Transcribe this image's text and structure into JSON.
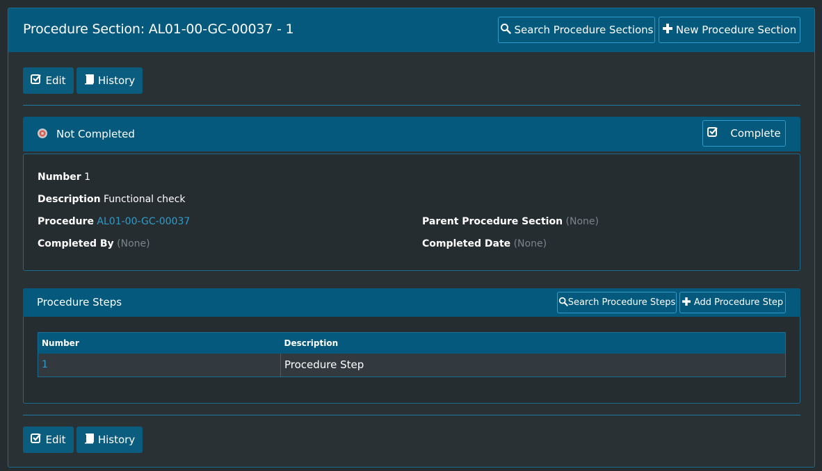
{
  "page": {
    "title": "Procedure Section: AL01-00-GC-00037 - 1",
    "search_sections_label": "Search Procedure Sections",
    "new_section_label": "New Procedure Section"
  },
  "toolbar_top": {
    "edit_label": "Edit",
    "history_label": "History"
  },
  "status": {
    "label": "Not Completed",
    "complete_label": "Complete",
    "icon_color": "#e05a4e"
  },
  "details": {
    "number_label": "Number",
    "number_value": "1",
    "description_label": "Description",
    "description_value": "Functional check",
    "procedure_label": "Procedure",
    "procedure_value": "AL01-00-GC-00037",
    "parent_label": "Parent Procedure Section",
    "parent_value": "(None)",
    "completed_by_label": "Completed By",
    "completed_by_value": "(None)",
    "completed_date_label": "Completed Date",
    "completed_date_value": "(None)"
  },
  "steps": {
    "title": "Procedure Steps",
    "search_label": "Search Procedure Steps",
    "add_label": "Add Procedure Step",
    "columns": [
      "Number",
      "Description"
    ],
    "rows": [
      {
        "number": "1",
        "description": "Procedure Step"
      }
    ]
  },
  "toolbar_bottom": {
    "edit_label": "Edit",
    "history_label": "History"
  },
  "colors": {
    "accent": "#04597d",
    "link": "#2f9ccc",
    "background": "#262d31"
  }
}
